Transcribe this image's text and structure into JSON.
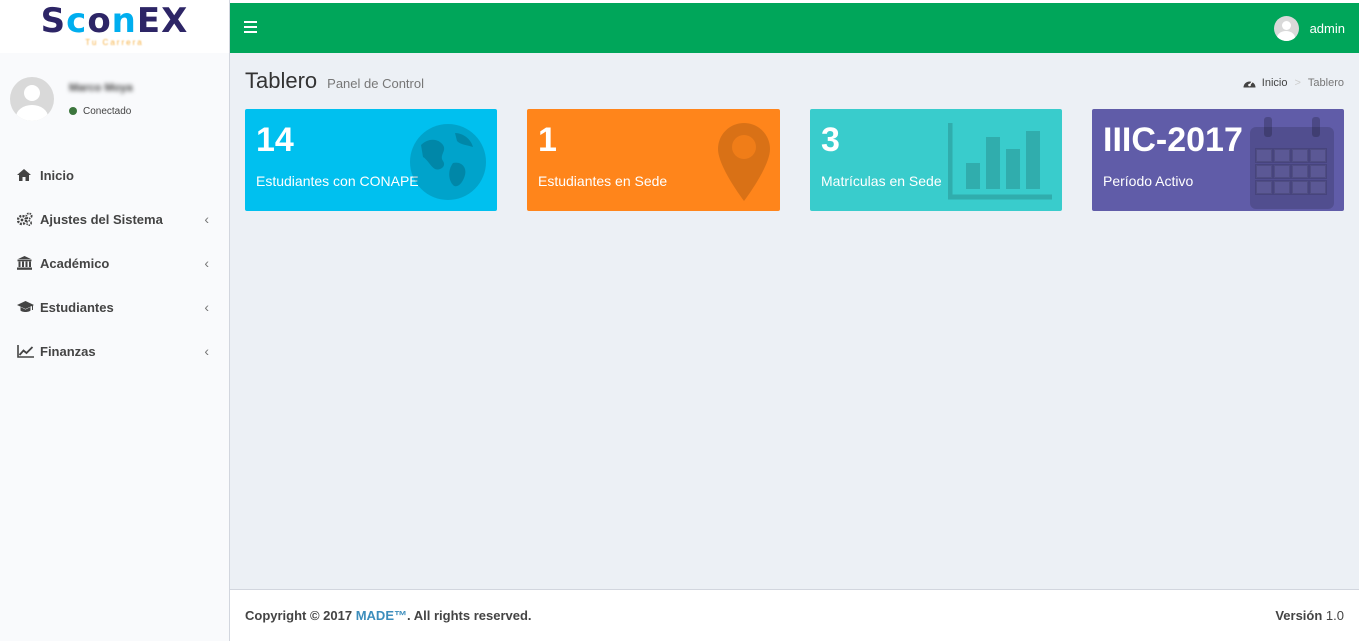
{
  "brand": {
    "logo_text": "Sconex",
    "logo_tagline": "Tu Carrera"
  },
  "user": {
    "name": "Marco Moya",
    "status": "Conectado",
    "header_name": "admin"
  },
  "menu": [
    {
      "label": "Inicio",
      "icon": "home-icon"
    },
    {
      "label": "Ajustes del Sistema",
      "icon": "cogs-icon"
    },
    {
      "label": "Académico",
      "icon": "bank-icon"
    },
    {
      "label": "Estudiantes",
      "icon": "graduation-cap-icon"
    },
    {
      "label": "Finanzas",
      "icon": "line-chart-icon"
    }
  ],
  "page": {
    "title": "Tablero",
    "subtitle": "Panel de Control"
  },
  "breadcrumb": {
    "home": "Inicio",
    "current": "Tablero"
  },
  "boxes": [
    {
      "value": "14",
      "label": "Estudiantes con CONAPE",
      "icon": "globe-icon",
      "color": "#00c0ef"
    },
    {
      "value": "1",
      "label": "Estudiantes en Sede",
      "icon": "map-marker-icon",
      "color": "#ff851b"
    },
    {
      "value": "3",
      "label": "Matrículas en Sede",
      "icon": "bar-chart-icon",
      "color": "#39cccc"
    },
    {
      "value": "IIIC-2017",
      "label": "Período Activo",
      "icon": "calendar-icon",
      "color": "#605ca8"
    }
  ],
  "footer": {
    "copyright_prefix": "Copyright © 2017 ",
    "company": "MADE™",
    "copyright_suffix": ". All rights reserved.",
    "version_label": "Versión",
    "version_value": "1.0"
  },
  "colors": {
    "header": "#00a65a",
    "sidebar_bg": "#f9fafc",
    "content_bg": "#ecf0f5"
  }
}
